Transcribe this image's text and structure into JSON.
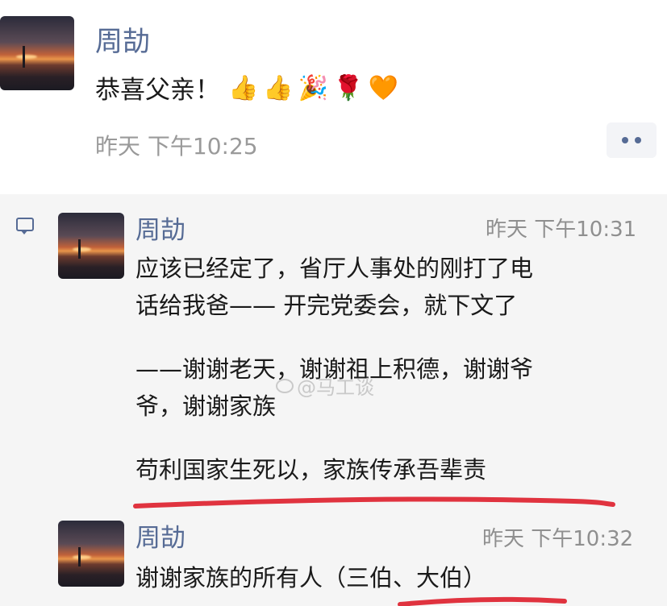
{
  "post": {
    "author": "周劼",
    "text": "恭喜父亲！",
    "emojis": [
      {
        "name": "thumbs-up-icon",
        "glyph": "👍"
      },
      {
        "name": "thumbs-up-icon",
        "glyph": "👍"
      },
      {
        "name": "party-popper-icon",
        "glyph": "🎉"
      },
      {
        "name": "rose-icon",
        "glyph": "🌹"
      },
      {
        "name": "orange-heart-icon",
        "glyph": "🧡"
      }
    ],
    "timestamp": "昨天 下午10:25"
  },
  "comments": [
    {
      "author": "周劼",
      "time": "昨天 下午10:31",
      "lines": [
        "应该已经定了，省厅人事处的刚打了电",
        "话给我爸—— 开完党委会，就下文了",
        "——谢谢老天，谢谢祖上积德，谢谢爷",
        "爷，谢谢家族",
        "苟利国家生死以，家族传承吾辈责"
      ]
    },
    {
      "author": "周劼",
      "time": "昨天 下午10:32",
      "lines": [
        "谢谢家族的所有人（三伯、大伯）"
      ]
    }
  ],
  "watermark": "@马工谈",
  "colors": {
    "name_link": "#566b95",
    "underline": "#e0333f",
    "comment_bg": "#f5f5f5"
  }
}
